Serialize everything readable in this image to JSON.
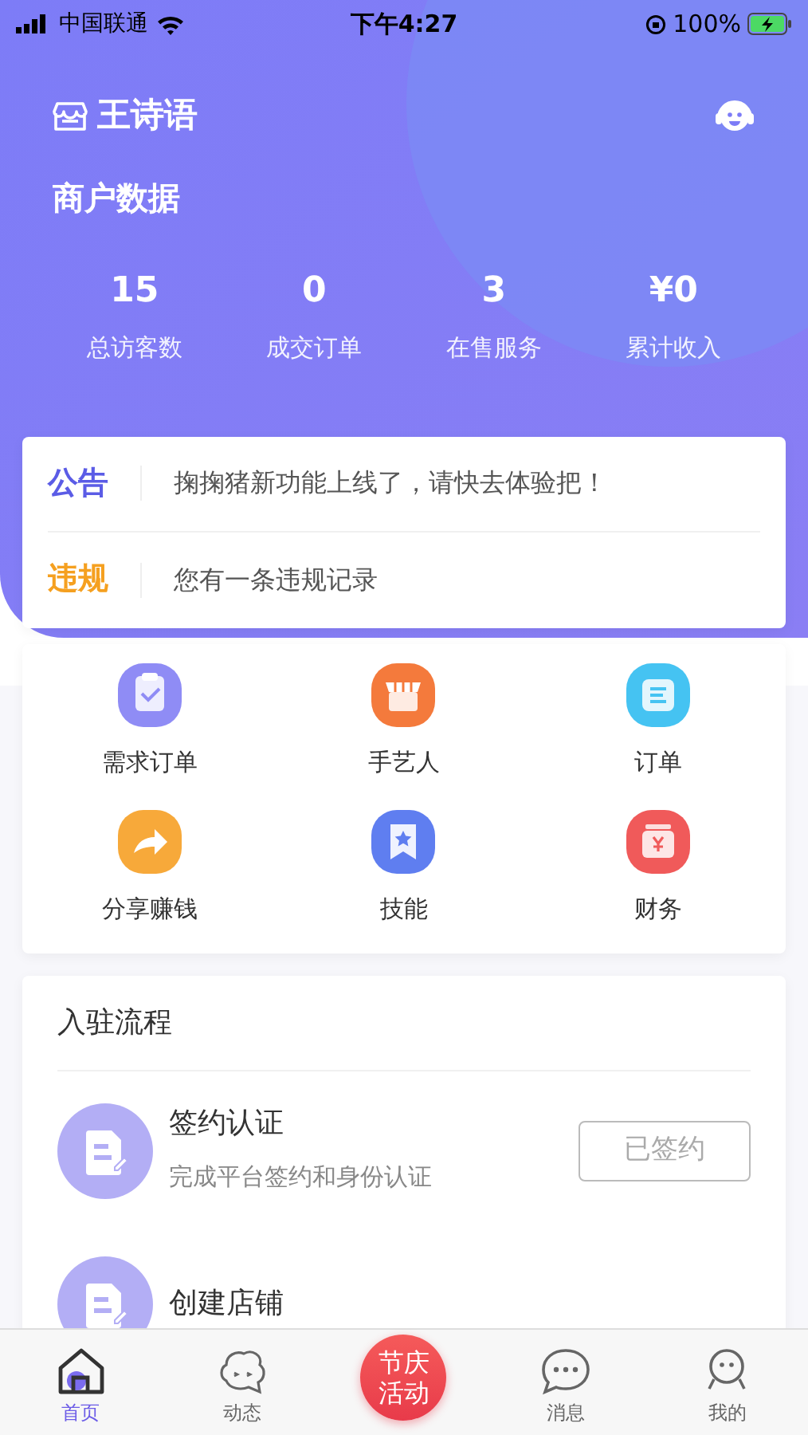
{
  "status_bar": {
    "carrier": "中国联通",
    "time": "下午4:27",
    "battery": "100%"
  },
  "header": {
    "shop_name": "王诗语",
    "section_title": "商户数据",
    "stats": [
      {
        "value": "15",
        "label": "总访客数"
      },
      {
        "value": "0",
        "label": "成交订单"
      },
      {
        "value": "3",
        "label": "在售服务"
      },
      {
        "value": "¥0",
        "label": "累计收入"
      }
    ]
  },
  "notices": [
    {
      "tag": "公告",
      "color": "#5b5ce6",
      "text": "掬掬猪新功能上线了，请快去体验把！"
    },
    {
      "tag": "违规",
      "color": "#f5a020",
      "text": "您有一条违规记录"
    }
  ],
  "shortcuts": [
    {
      "label": "需求订单",
      "color": "#8f8cf5"
    },
    {
      "label": "手艺人",
      "color": "#f47a3c"
    },
    {
      "label": "订单",
      "color": "#45c3f2"
    },
    {
      "label": "分享赚钱",
      "color": "#f7a93a"
    },
    {
      "label": "技能",
      "color": "#5f7ef0"
    },
    {
      "label": "财务",
      "color": "#f05a5a"
    }
  ],
  "process": {
    "title": "入驻流程",
    "steps": [
      {
        "title": "签约认证",
        "subtitle": "完成平台签约和身份认证",
        "button": "已签约"
      },
      {
        "title": "创建店铺"
      }
    ]
  },
  "tab_bar": [
    {
      "kind": "home",
      "label": "首页",
      "selected": true
    },
    {
      "kind": "moments",
      "label": "动态",
      "selected": false
    },
    {
      "kind": "festival",
      "label": "节庆活动",
      "selected": false
    },
    {
      "kind": "messages",
      "label": "消息",
      "selected": false
    },
    {
      "kind": "profile",
      "label": "我的",
      "selected": false
    }
  ]
}
